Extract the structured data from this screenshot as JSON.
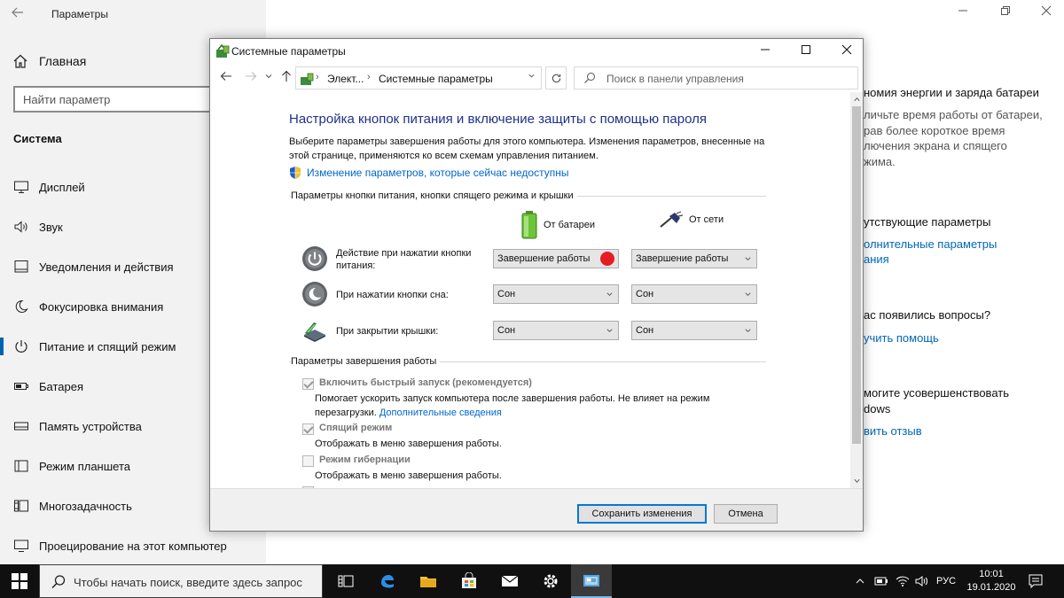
{
  "settings": {
    "window_title": "Параметры",
    "home_label": "Главная",
    "search_placeholder": "Найти параметр",
    "section_label": "Система",
    "nav_items": [
      {
        "label": "Дисплей",
        "icon": "monitor-icon"
      },
      {
        "label": "Звук",
        "icon": "speaker-icon"
      },
      {
        "label": "Уведомления и действия",
        "icon": "notification-icon"
      },
      {
        "label": "Фокусировка внимания",
        "icon": "moon-icon"
      },
      {
        "label": "Питание и спящий режим",
        "icon": "power-icon"
      },
      {
        "label": "Батарея",
        "icon": "battery-icon"
      },
      {
        "label": "Память устройства",
        "icon": "storage-icon"
      },
      {
        "label": "Режим планшета",
        "icon": "tablet-icon"
      },
      {
        "label": "Многозадачность",
        "icon": "multitask-icon"
      },
      {
        "label": "Проецирование на этот компьютер",
        "icon": "project-icon"
      }
    ],
    "active_item": 4,
    "right_panel": {
      "energy_title": "номия энергии и заряда батареи",
      "energy_lines": [
        "личьте время работы от батареи,",
        "рав более короткое время",
        "лючения экрана и спящего",
        "жима."
      ],
      "related_title": "утствующие параметры",
      "related_links": [
        "олнительные параметры",
        "ания"
      ],
      "questions_title": "ас появились вопросы?",
      "help_link": "учить помощь",
      "improve_lines": [
        "могите усовершенствовать",
        "dows"
      ],
      "feedback_link": "вить отзыв"
    }
  },
  "dialog": {
    "title": "Системные параметры",
    "breadcrumb": [
      "Элект...",
      "Системные параметры"
    ],
    "search_placeholder": "Поиск в панели управления",
    "heading": "Настройка кнопок питания и включение защиты с помощью пароля",
    "description": "Выберите параметры завершения работы для этого компьютера. Изменения параметров, внесенные на этой странице, применяются ко всем схемам управления питанием.",
    "change_link": "Изменение параметров, которые сейчас недоступны",
    "group1_title": "Параметры кнопки питания, кнопки спящего режима и крышки",
    "col_battery": "От батареи",
    "col_ac": "От сети",
    "rows": [
      {
        "label": "Действие при нажатии кнопки питания:",
        "battery": "Завершение работы",
        "ac": "Завершение работы",
        "icon": "power-button-icon"
      },
      {
        "label": "При нажатии кнопки сна:",
        "battery": "Сон",
        "ac": "Сон",
        "icon": "sleep-button-icon"
      },
      {
        "label": "При закрытии крышки:",
        "battery": "Сон",
        "ac": "Сон",
        "icon": "laptop-lid-icon"
      }
    ],
    "group2_title": "Параметры завершения работы",
    "options": [
      {
        "label": "Включить быстрый запуск (рекомендуется)",
        "checked": true,
        "desc1": "Помогает ускорить запуск компьютера после завершения работы. Не влияет на режим",
        "desc2": "перезагрузки.",
        "link": "Дополнительные сведения"
      },
      {
        "label": "Спящий режим",
        "checked": true,
        "desc1": "Отображать в меню завершения работы."
      },
      {
        "label": "Режим гибернации",
        "checked": false,
        "desc1": "Отображать в меню завершения работы."
      }
    ],
    "save_button": "Сохранить изменения",
    "cancel_button": "Отмена"
  },
  "taskbar": {
    "search_placeholder": "Чтобы начать поиск, введите здесь запрос",
    "language": "РУС",
    "time": "10:01",
    "date": "19.01.2020"
  },
  "colors": {
    "accent": "#0078d7",
    "heading": "#1e3287",
    "link": "#0066cc",
    "taskbar": "#101010",
    "red_dot": "#e51c23"
  }
}
